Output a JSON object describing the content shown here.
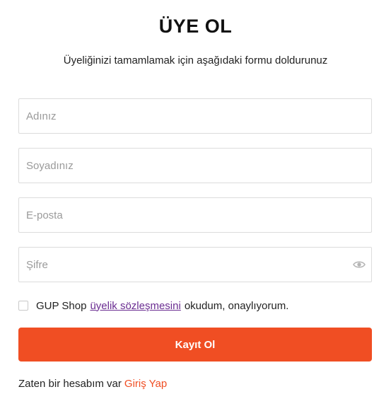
{
  "header": {
    "title": "ÜYE OL",
    "subtitle": "Üyeliğinizi tamamlamak için aşağıdaki formu doldurunuz"
  },
  "form": {
    "first_name": {
      "placeholder": "Adınız",
      "value": ""
    },
    "last_name": {
      "placeholder": "Soyadınız",
      "value": ""
    },
    "email": {
      "placeholder": "E-posta",
      "value": ""
    },
    "password": {
      "placeholder": "Şifre",
      "value": "",
      "toggle_icon": "eye-icon"
    },
    "terms": {
      "checked": false,
      "prefix": "GUP Shop",
      "link_text": "üyelik sözleşmesini",
      "suffix": "okudum, onaylıyorum."
    },
    "submit_label": "Kayıt Ol"
  },
  "footer": {
    "text": "Zaten bir hesabım var",
    "login_link": "Giriş Yap"
  },
  "colors": {
    "accent": "#f04e23",
    "link": "#6a2c91",
    "border": "#dcdcdc",
    "placeholder": "#9a9a9a"
  }
}
